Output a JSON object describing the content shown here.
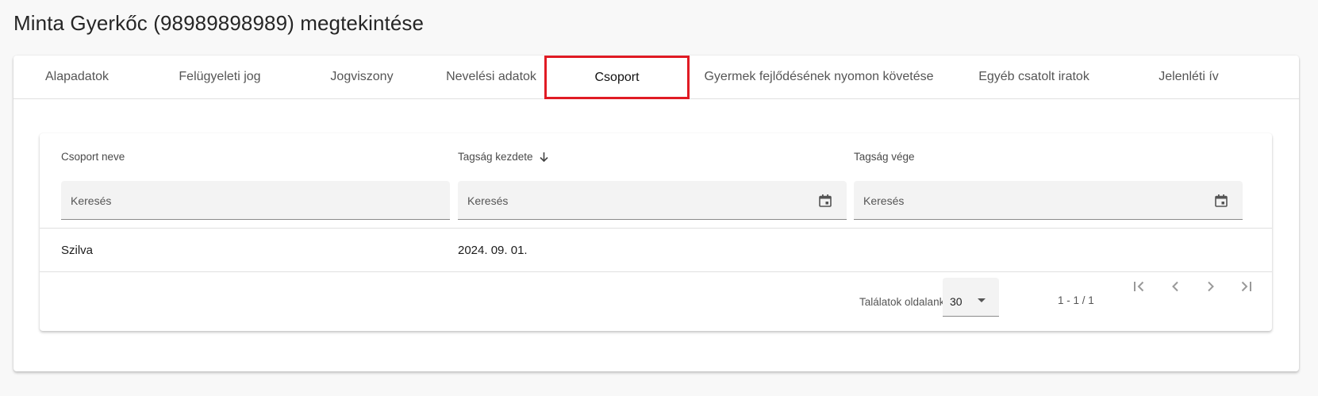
{
  "page": {
    "title": "Minta Gyerkőc (98989898989) megtekintése"
  },
  "tabs": [
    {
      "label": "Alapadatok"
    },
    {
      "label": "Felügyeleti jog"
    },
    {
      "label": "Jogviszony"
    },
    {
      "label": "Nevelési adatok"
    },
    {
      "label": "Csoport"
    },
    {
      "label": "Gyermek fejlődésének nyomon követése"
    },
    {
      "label": "Egyéb csatolt iratok"
    },
    {
      "label": "Jelenléti ív"
    }
  ],
  "active_tab": "Csoport",
  "table": {
    "columns": [
      {
        "label": "Csoport neve",
        "filter_placeholder": "Keresés"
      },
      {
        "label": "Tagság kezdete",
        "filter_placeholder": "Keresés",
        "sort": "desc"
      },
      {
        "label": "Tagság vége",
        "filter_placeholder": "Keresés"
      }
    ],
    "rows": [
      {
        "group": "Szilva",
        "start": "2024. 09. 01.",
        "end": ""
      }
    ]
  },
  "paginator": {
    "page_size_label": "Találatok oldalanként",
    "page_size": "30",
    "range": "1 - 1 / 1"
  },
  "colors": {
    "highlight": "#e01b24",
    "background": "#f8f8f8"
  },
  "icons": {
    "sort": "arrow-down-icon",
    "calendar": "calendar-icon",
    "first": "first-page-icon",
    "prev": "chevron-left-icon",
    "next": "chevron-right-icon",
    "last": "last-page-icon",
    "dropdown": "dropdown-arrow-icon"
  }
}
